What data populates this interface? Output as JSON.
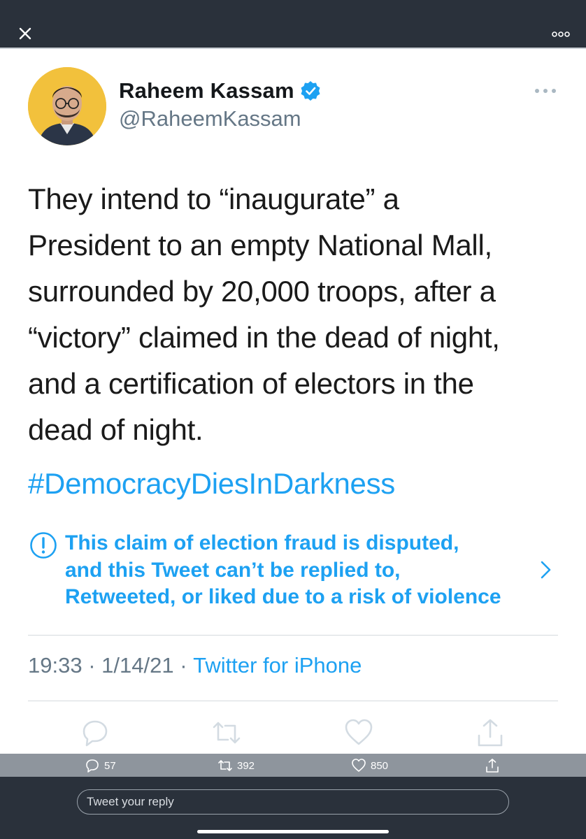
{
  "tweet": {
    "display_name": "Raheem Kassam",
    "handle": "@RaheemKassam",
    "text": "They intend to “inaugurate” a\nPresident to an empty National Mall,\nsurrounded by 20,000 troops, after a\n“victory” claimed in the dead of night,\nand a certification of electors in the\ndead of night.",
    "hashtag": "#DemocracyDiesInDarkness",
    "notice": "This claim of election fraud is disputed,\nand this Tweet can’t be replied to,\nRetweeted, or liked due to a risk of violence",
    "time": "19:33",
    "date": "1/14/21",
    "separator": " · ",
    "source": "Twitter for iPhone"
  },
  "counts": {
    "replies": "57",
    "retweets": "392",
    "likes": "850"
  },
  "reply_bar": {
    "placeholder": "Tweet your reply"
  },
  "icons": {
    "close": "close-icon",
    "more": "more-icon",
    "verified": "verified-badge-icon",
    "warning": "exclamation-circle-icon",
    "chevron": "chevron-right-icon",
    "reply": "reply-icon",
    "retweet": "retweet-icon",
    "like": "heart-icon",
    "share": "share-icon"
  },
  "colors": {
    "accent": "#1da1f2",
    "chrome": "#2a313b",
    "muted": "#657786",
    "avatar_bg": "#f2c13c"
  }
}
